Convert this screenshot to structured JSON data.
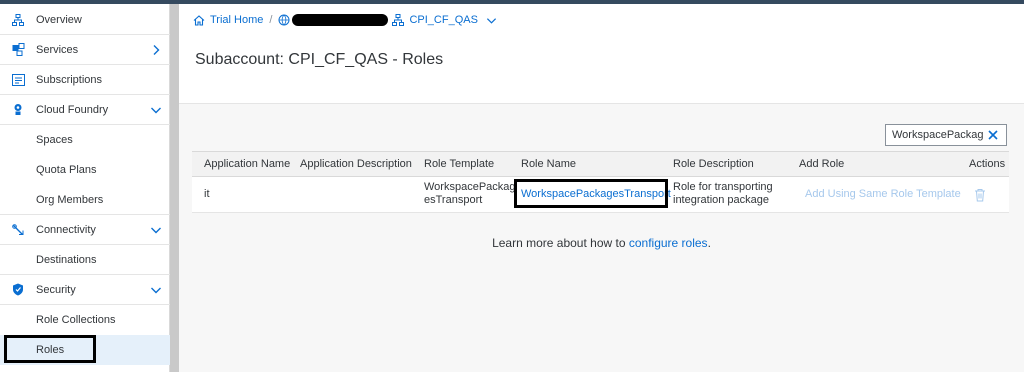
{
  "colors": {
    "accent": "#0a6ed1",
    "shell": "#354a5f",
    "text": "#32363a"
  },
  "sidebar": {
    "items": [
      {
        "label": "Overview",
        "icon": "org-icon",
        "has_chevron": false
      },
      {
        "label": "Services",
        "icon": "services-icon",
        "chevron": "chevron-right-icon"
      },
      {
        "label": "Subscriptions",
        "icon": "subscriptions-icon",
        "has_chevron": false
      },
      {
        "label": "Cloud Foundry",
        "icon": "cloud-foundry-icon",
        "chevron": "chevron-down-icon"
      },
      {
        "label": "Spaces"
      },
      {
        "label": "Quota Plans"
      },
      {
        "label": "Org Members"
      },
      {
        "label": "Connectivity",
        "icon": "connectivity-icon",
        "chevron": "chevron-down-icon"
      },
      {
        "label": "Destinations"
      },
      {
        "label": "Security",
        "icon": "security-icon",
        "chevron": "chevron-down-icon"
      },
      {
        "label": "Role Collections"
      },
      {
        "label": "Roles",
        "selected": true
      }
    ]
  },
  "breadcrumb": {
    "home": "Trial Home",
    "separator": "/",
    "current": "CPI_CF_QAS"
  },
  "page": {
    "title": "Subaccount: CPI_CF_QAS - Roles"
  },
  "filter": {
    "value": "WorkspacePackag"
  },
  "table": {
    "headers": [
      "Application Name",
      "Application Description",
      "Role Template",
      "Role Name",
      "Role Description",
      "Add Role",
      "Actions"
    ],
    "rows": [
      {
        "app_name": "it",
        "app_description": "",
        "role_template_line1": "WorkspacePackag",
        "role_template_line2": "esTransport",
        "role_name": "WorkspacePackagesTransport",
        "role_description_line1": "Role for transporting",
        "role_description_line2": "integration package",
        "add_role": "Add Using Same Role Template"
      }
    ]
  },
  "footer": {
    "learn_prefix": "Learn more about how to ",
    "learn_link": "configure roles",
    "learn_suffix": "."
  }
}
